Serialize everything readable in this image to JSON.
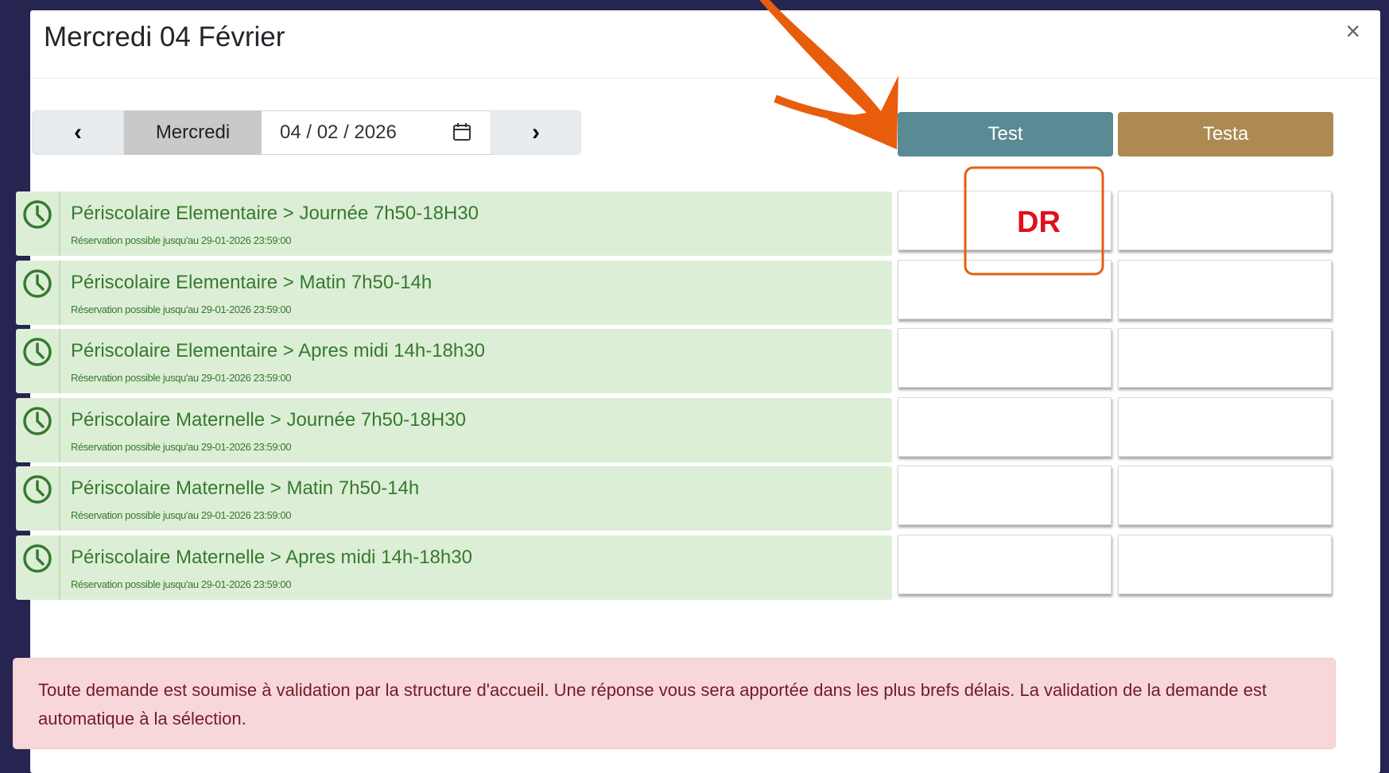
{
  "modal": {
    "title": "Mercredi 04 Février",
    "close_label": "×"
  },
  "date_nav": {
    "prev_icon": "‹",
    "day_label": "Mercredi",
    "date_value": "04 / 02 / 2026",
    "next_icon": "›"
  },
  "columns": [
    {
      "label": "Test",
      "color": "#5a8a94"
    },
    {
      "label": "Testa",
      "color": "#ad8a52"
    }
  ],
  "rows": [
    {
      "title": "Périscolaire Elementaire > Journée 7h50-18H30",
      "subtitle": "Réservation possible jusqu'au 29-01-2026 23:59:00"
    },
    {
      "title": "Périscolaire Elementaire > Matin 7h50-14h",
      "subtitle": "Réservation possible jusqu'au 29-01-2026 23:59:00"
    },
    {
      "title": "Périscolaire Elementaire > Apres midi 14h-18h30",
      "subtitle": "Réservation possible jusqu'au 29-01-2026 23:59:00"
    },
    {
      "title": "Périscolaire Maternelle > Journée 7h50-18H30",
      "subtitle": "Réservation possible jusqu'au 29-01-2026 23:59:00"
    },
    {
      "title": "Périscolaire Maternelle > Matin 7h50-14h",
      "subtitle": "Réservation possible jusqu'au 29-01-2026 23:59:00"
    },
    {
      "title": "Périscolaire Maternelle > Apres midi 14h-18h30",
      "subtitle": "Réservation possible jusqu'au 29-01-2026 23:59:00"
    }
  ],
  "annotation": {
    "label": "DR",
    "color": "#e0101b",
    "arrow_color": "#e85d0c"
  },
  "alert": {
    "text": "Toute demande est soumise à validation par la structure d'accueil. Une réponse vous sera apportée dans les plus brefs délais. La validation de la demande est automatique à la sélection."
  },
  "colors": {
    "background": "#262450",
    "row_bg": "#ddeed6",
    "row_text": "#357a30",
    "alert_bg": "#f8d7da",
    "alert_text": "#721c24"
  }
}
